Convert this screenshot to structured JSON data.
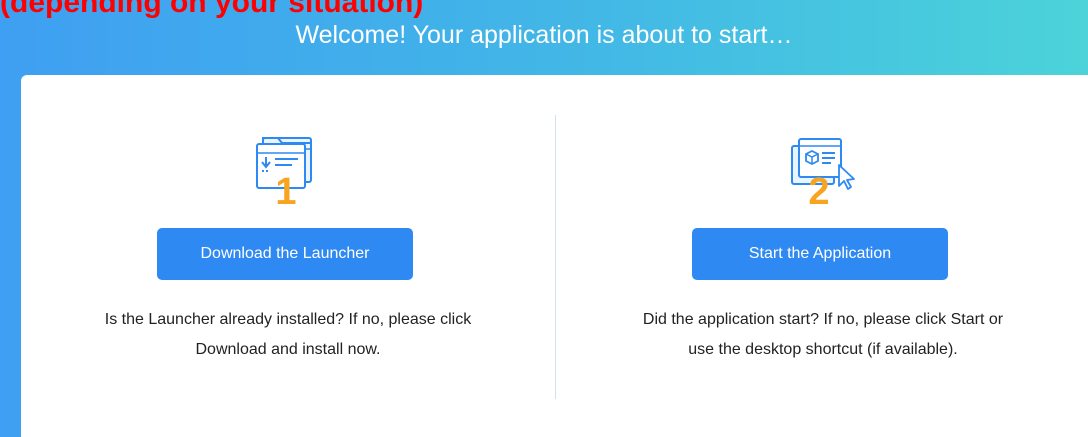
{
  "caption": "(depending on your situation)",
  "header": {
    "title": "Welcome! Your application is about to start…"
  },
  "steps": [
    {
      "number": "1",
      "icon": "download-folder-icon",
      "button_label": "Download the Launcher",
      "description_line1": "Is the Launcher already installed? If no, please click",
      "description_line2": "Download and install now."
    },
    {
      "number": "2",
      "icon": "application-window-icon",
      "button_label": "Start the Application",
      "description_line1": "Did the application start? If no, please click Start or",
      "description_line2": "use the desktop shortcut (if available)."
    }
  ],
  "colors": {
    "banner_start": "#3f9ff2",
    "banner_end": "#4bd3d9",
    "button": "#2e89f2",
    "step_number": "#f7a421",
    "icon_stroke": "#2e89f2",
    "caption": "#ff0000"
  }
}
